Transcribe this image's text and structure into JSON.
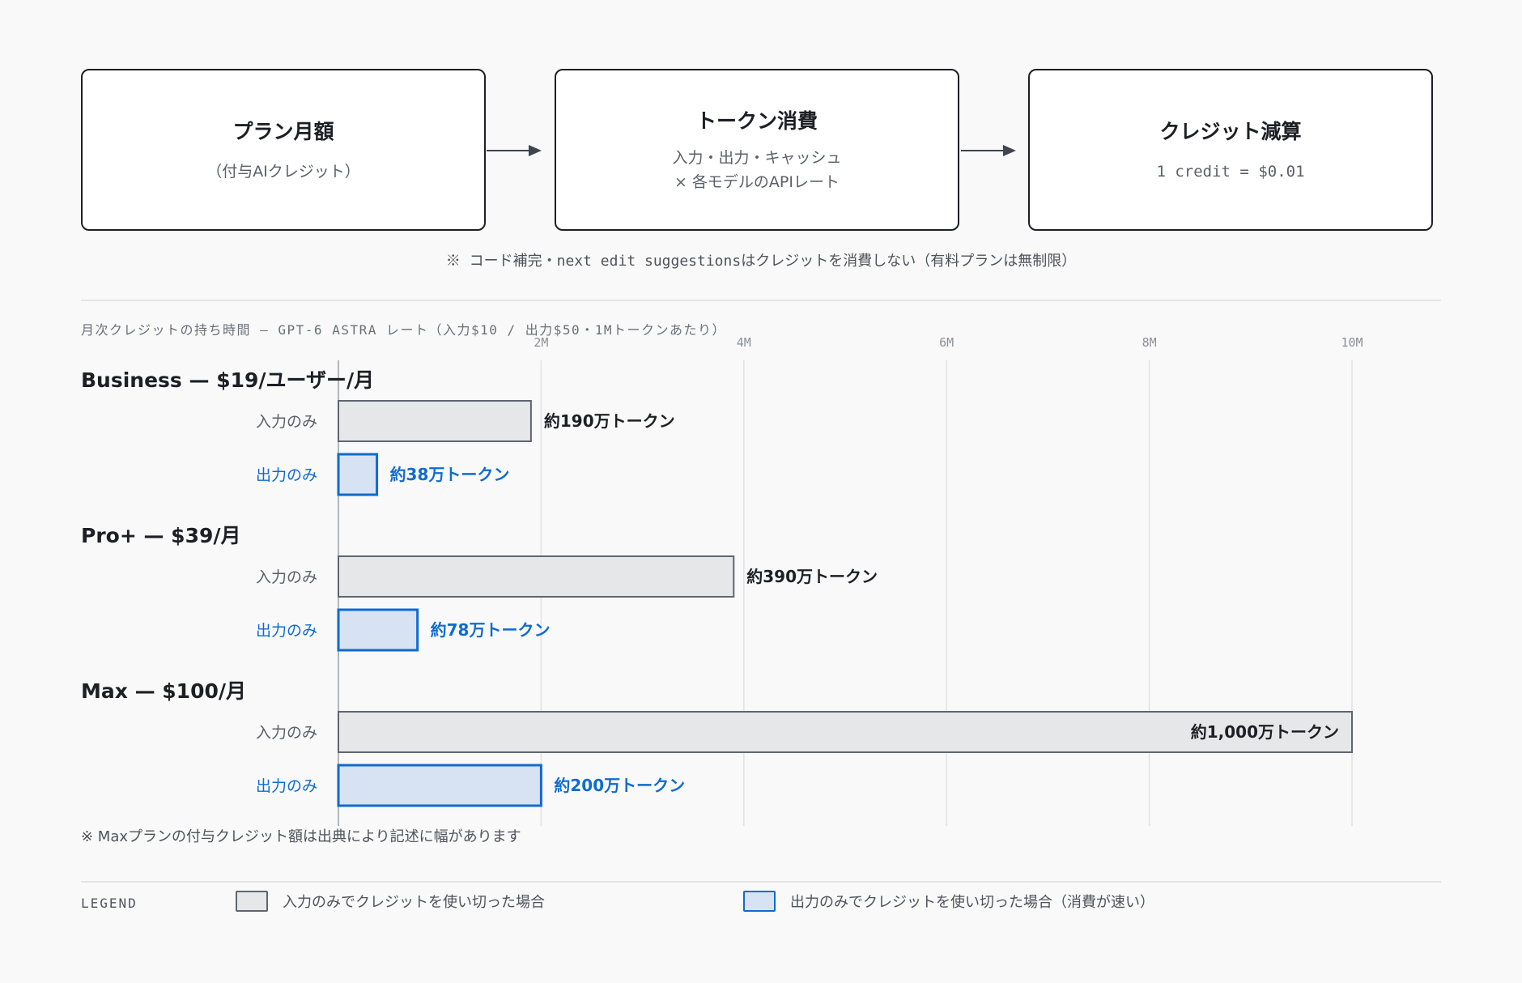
{
  "flow": {
    "boxes": [
      {
        "title": "プラン月額",
        "lines": [
          "（付与AIクレジット）"
        ]
      },
      {
        "title": "トークン消費",
        "lines": [
          "入力・出力・キャッシュ",
          "× 各モデルのAPIレート"
        ]
      },
      {
        "title": "クレジット減算",
        "lines": [
          "1 credit = $0.01"
        ]
      }
    ],
    "note": "※ コード補完・next edit suggestionsはクレジットを消費しない（有料プランは無制限）"
  },
  "chart_data": {
    "type": "bar",
    "orientation": "horizontal",
    "title": "月次クレジットの持ち時間 — GPT-6 ASTRA レート（入力$10 / 出力$50・1Mトークンあたり）",
    "x_ticks": [
      "2M",
      "4M",
      "6M",
      "8M",
      "10M"
    ],
    "x_tick_values": [
      2000000,
      4000000,
      6000000,
      8000000,
      10000000
    ],
    "xlim": [
      0,
      10000000
    ],
    "grid": true,
    "groups": [
      {
        "name": "Business — $19/ユーザー/月",
        "bars": [
          {
            "series": "input",
            "label": "入力のみ",
            "value": 1900000,
            "data_label": "約190万トークン"
          },
          {
            "series": "output",
            "label": "出力のみ",
            "value": 380000,
            "data_label": "約38万トークン"
          }
        ]
      },
      {
        "name": "Pro+ — $39/月",
        "bars": [
          {
            "series": "input",
            "label": "入力のみ",
            "value": 3900000,
            "data_label": "約390万トークン"
          },
          {
            "series": "output",
            "label": "出力のみ",
            "value": 780000,
            "data_label": "約78万トークン"
          }
        ]
      },
      {
        "name": "Max — $100/月",
        "bars": [
          {
            "series": "input",
            "label": "入力のみ",
            "value": 10000000,
            "data_label": "約1,000万トークン"
          },
          {
            "series": "output",
            "label": "出力のみ",
            "value": 2000000,
            "data_label": "約200万トークン"
          }
        ]
      }
    ],
    "colors": {
      "input_fill": "#e6e7e9",
      "input_stroke": "#5f6570",
      "input_label": "#5a5f69",
      "output_fill": "#d7e3f3",
      "output_stroke": "#0f6bd0",
      "output_label": "#0f6bd0",
      "grid": "#e2e2e2",
      "axis": "#9aa0a8"
    }
  },
  "source_note": "※ Maxプランの付与クレジット額は出典により記述に幅があります",
  "legend": {
    "title": "LEGEND",
    "items": [
      {
        "label": "入力のみでクレジットを使い切った場合",
        "fill": "#e6e7e9",
        "stroke": "#5f6570"
      },
      {
        "label": "出力のみでクレジットを使い切った場合（消費が速い）",
        "fill": "#d7e3f3",
        "stroke": "#0f6bd0"
      }
    ]
  }
}
